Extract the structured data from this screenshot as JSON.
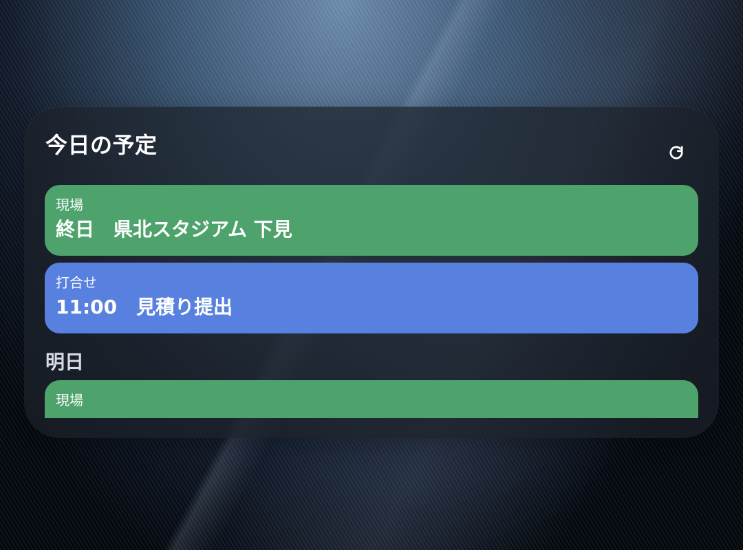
{
  "widget": {
    "title": "今日の予定",
    "refresh_icon": "refresh-icon"
  },
  "today": {
    "events": [
      {
        "label": "現場",
        "title": "終日　県北スタジアム 下見",
        "color": "#4ea36c"
      },
      {
        "label": "打合せ",
        "title": "11:00　見積り提出",
        "color": "#5880df"
      }
    ]
  },
  "tomorrow": {
    "heading": "明日",
    "events": [
      {
        "label": "現場",
        "title": "",
        "color": "#4ea36c"
      }
    ]
  }
}
